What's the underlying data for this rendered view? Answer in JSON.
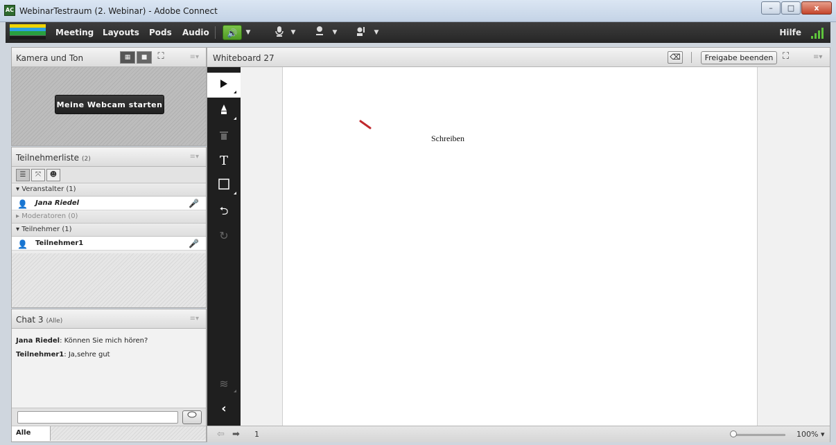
{
  "window": {
    "title": "WebinarTestraum (2. Webinar) - Adobe Connect",
    "app_icon_glyph": "AC",
    "buttons": {
      "minimize": "–",
      "maximize": "□",
      "close": "x"
    }
  },
  "menubar": {
    "items": [
      "Meeting",
      "Layouts",
      "Pods",
      "Audio"
    ],
    "help_label": "Hilfe",
    "accent_color": "#5ec43c"
  },
  "camera_pod": {
    "title": "Kamera und Ton",
    "start_webcam_label": "Meine Webcam starten"
  },
  "attendees_pod": {
    "title": "Teilnehmerliste",
    "count": "(2)",
    "groups": [
      {
        "label": "Veranstalter (1)"
      },
      {
        "label": "Moderatoren (0)"
      },
      {
        "label": "Teilnehmer (1)"
      }
    ],
    "host": {
      "name": "Jana Riedel"
    },
    "participant": {
      "name": "Teilnehmer1"
    }
  },
  "chat_pod": {
    "title": "Chat 3",
    "scope": "(Alle)",
    "messages": [
      {
        "sender": "Jana Riedel",
        "text": "Können Sie mich hören?"
      },
      {
        "sender": "Teilnehmer1",
        "text": "Ja,sehre gut"
      }
    ],
    "input_value": "",
    "tab_label": "Alle"
  },
  "whiteboard": {
    "title": "Whiteboard 27",
    "stop_sharing_label": "Freigabe beenden",
    "canvas_text": "Schreiben",
    "stroke_color": "#c0282d",
    "page_number": "1",
    "zoom_label": "100%",
    "tools": [
      "select",
      "marker",
      "delete",
      "text",
      "shape",
      "undo",
      "redo",
      "layers",
      "collapse"
    ]
  }
}
